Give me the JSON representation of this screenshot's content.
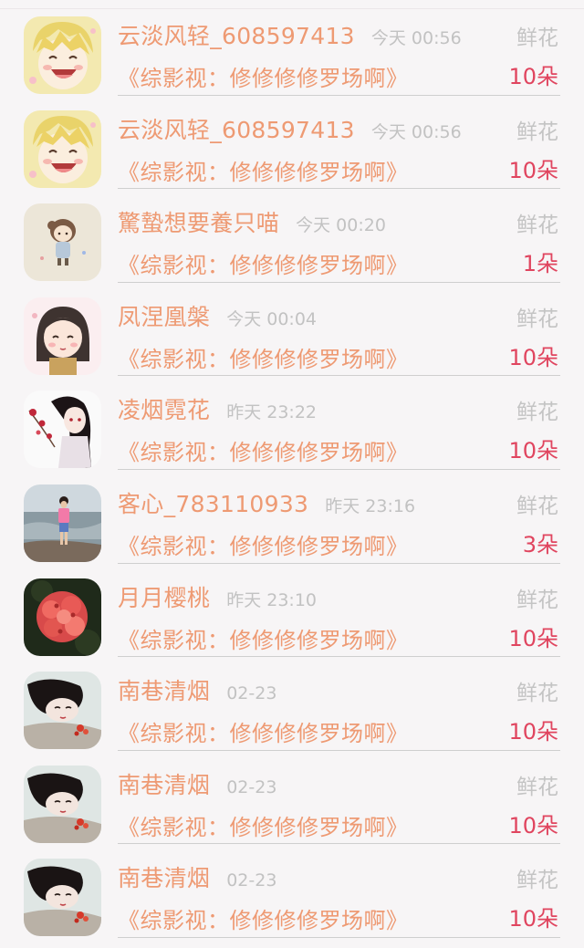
{
  "rows": [
    {
      "name": "云淡风轻_608597413",
      "time": "今天 00:56",
      "gift": "鲜花",
      "book": "《综影视：修修修修罗场啊》",
      "count": "10朵",
      "avatar": "anime-boy-icon"
    },
    {
      "name": "云淡风轻_608597413",
      "time": "今天 00:56",
      "gift": "鲜花",
      "book": "《综影视：修修修修罗场啊》",
      "count": "10朵",
      "avatar": "anime-boy-icon"
    },
    {
      "name": "驚蟄想要養只喵",
      "time": "今天 00:20",
      "gift": "鲜花",
      "book": "《综影视：修修修修罗场啊》",
      "count": "1朵",
      "avatar": "chibi-girl-icon"
    },
    {
      "name": "凤涅凰槃",
      "time": "今天 00:04",
      "gift": "鲜花",
      "book": "《综影视：修修修修罗场啊》",
      "count": "10朵",
      "avatar": "anime-girl-icon"
    },
    {
      "name": "凌烟霓花",
      "time": "昨天 23:22",
      "gift": "鲜花",
      "book": "《综影视：修修修修罗场啊》",
      "count": "10朵",
      "avatar": "kimono-girl-icon"
    },
    {
      "name": "客心_783110933",
      "time": "昨天 23:16",
      "gift": "鲜花",
      "book": "《综影视：修修修修罗场啊》",
      "count": "3朵",
      "avatar": "beach-photo-icon"
    },
    {
      "name": "月月樱桃",
      "time": "昨天 23:10",
      "gift": "鲜花",
      "book": "《综影视：修修修修罗场啊》",
      "count": "10朵",
      "avatar": "flower-photo-icon"
    },
    {
      "name": "南巷清烟",
      "time": "02-23",
      "gift": "鲜花",
      "book": "《综影视：修修修修罗场啊》",
      "count": "10朵",
      "avatar": "lying-girl-icon"
    },
    {
      "name": "南巷清烟",
      "time": "02-23",
      "gift": "鲜花",
      "book": "《综影视：修修修修罗场啊》",
      "count": "10朵",
      "avatar": "lying-girl-icon"
    },
    {
      "name": "南巷清烟",
      "time": "02-23",
      "gift": "鲜花",
      "book": "《综影视：修修修修罗场啊》",
      "count": "10朵",
      "avatar": "lying-girl-icon"
    }
  ],
  "colors": {
    "name": "#ee9a73",
    "time": "#c2c2c2",
    "gift": "#c4c4c4",
    "count": "#e0455f",
    "background": "#f7f5f6"
  }
}
